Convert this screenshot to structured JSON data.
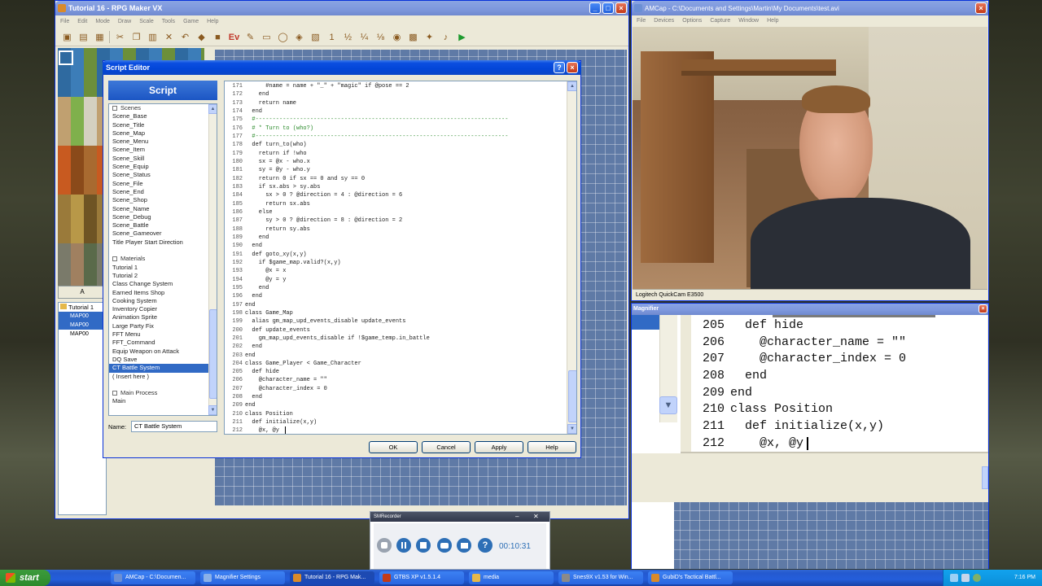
{
  "rpg_window": {
    "title": "Tutorial 16 - RPG Maker VX",
    "menu": [
      "File",
      "Edit",
      "Mode",
      "Draw",
      "Scale",
      "Tools",
      "Game",
      "Help"
    ],
    "palette_tab": "A",
    "map_tree_root": "Tutorial 1",
    "map_tree_items": [
      "MAP00",
      "MAP00",
      "MAP00"
    ]
  },
  "script_editor": {
    "title": "Script Editor",
    "help_icon": "?",
    "script_header": "Script",
    "list_items": [
      {
        "label": "Scenes",
        "head": true
      },
      {
        "label": "Scene_Base"
      },
      {
        "label": "Scene_Title"
      },
      {
        "label": "Scene_Map"
      },
      {
        "label": "Scene_Menu"
      },
      {
        "label": "Scene_Item"
      },
      {
        "label": "Scene_Skill"
      },
      {
        "label": "Scene_Equip"
      },
      {
        "label": "Scene_Status"
      },
      {
        "label": "Scene_File"
      },
      {
        "label": "Scene_End"
      },
      {
        "label": "Scene_Shop"
      },
      {
        "label": "Scene_Name"
      },
      {
        "label": "Scene_Debug"
      },
      {
        "label": "Scene_Battle"
      },
      {
        "label": "Scene_Gameover"
      },
      {
        "label": "Title Player Start Direction"
      },
      {
        "label": ""
      },
      {
        "label": "Materials",
        "head": true
      },
      {
        "label": "Tutorial 1"
      },
      {
        "label": "Tutorial 2"
      },
      {
        "label": "Class Change System"
      },
      {
        "label": "Earned Items Shop"
      },
      {
        "label": "Cooking System"
      },
      {
        "label": "Inventory Copier"
      },
      {
        "label": "Animation Sprite"
      },
      {
        "label": "Large Party Fix"
      },
      {
        "label": "FFT Menu"
      },
      {
        "label": "FFT_Command"
      },
      {
        "label": "Equip Weapon on Attack"
      },
      {
        "label": "DQ Save"
      },
      {
        "label": "CT Battle System",
        "selected": true
      },
      {
        "label": "( Insert here )"
      },
      {
        "label": ""
      },
      {
        "label": "Main Process",
        "head": true
      },
      {
        "label": "Main"
      }
    ],
    "name_label": "Name:",
    "name_value": "CT Battle System",
    "code_lines": [
      {
        "n": "171",
        "t": "      #name = name + \"_\" + \"magic\" if @pose == 2"
      },
      {
        "n": "172",
        "t": "    end"
      },
      {
        "n": "173",
        "t": "    return name"
      },
      {
        "n": "174",
        "t": "  end"
      },
      {
        "n": "175",
        "t": "  #--------------------------------------------------------------------------",
        "c": true
      },
      {
        "n": "176",
        "t": "  # * Turn to (who?)",
        "c": true
      },
      {
        "n": "177",
        "t": "  #--------------------------------------------------------------------------",
        "c": true
      },
      {
        "n": "178",
        "t": "  def turn_to(who)"
      },
      {
        "n": "179",
        "t": "    return if !who"
      },
      {
        "n": "180",
        "t": "    sx = @x - who.x"
      },
      {
        "n": "181",
        "t": "    sy = @y - who.y"
      },
      {
        "n": "182",
        "t": "    return 0 if sx == 0 and sy == 0"
      },
      {
        "n": "183",
        "t": "    if sx.abs > sy.abs"
      },
      {
        "n": "184",
        "t": "      sx > 0 ? @direction = 4 : @direction = 6"
      },
      {
        "n": "185",
        "t": "      return sx.abs"
      },
      {
        "n": "186",
        "t": "    else"
      },
      {
        "n": "187",
        "t": "      sy > 0 ? @direction = 8 : @direction = 2"
      },
      {
        "n": "188",
        "t": "      return sy.abs"
      },
      {
        "n": "189",
        "t": "    end"
      },
      {
        "n": "190",
        "t": "  end"
      },
      {
        "n": "191",
        "t": "  def goto_xy(x,y)"
      },
      {
        "n": "192",
        "t": "    if $game_map.valid?(x,y)"
      },
      {
        "n": "193",
        "t": "      @x = x"
      },
      {
        "n": "194",
        "t": "      @y = y"
      },
      {
        "n": "195",
        "t": "    end"
      },
      {
        "n": "196",
        "t": "  end"
      },
      {
        "n": "197",
        "t": "end"
      },
      {
        "n": "198",
        "t": "class Game_Map"
      },
      {
        "n": "199",
        "t": "  alias gm_map_upd_events_disable update_events"
      },
      {
        "n": "200",
        "t": "  def update_events"
      },
      {
        "n": "201",
        "t": "    gm_map_upd_events_disable if !$game_temp.in_battle"
      },
      {
        "n": "202",
        "t": "  end"
      },
      {
        "n": "203",
        "t": "end"
      },
      {
        "n": "204",
        "t": "class Game_Player < Game_Character"
      },
      {
        "n": "205",
        "t": "  def hide"
      },
      {
        "n": "206",
        "t": "    @character_name = \"\""
      },
      {
        "n": "207",
        "t": "    @character_index = 0"
      },
      {
        "n": "208",
        "t": "  end"
      },
      {
        "n": "209",
        "t": "end"
      },
      {
        "n": "210",
        "t": "class Position"
      },
      {
        "n": "211",
        "t": "  def initialize(x,y)"
      },
      {
        "n": "212",
        "t": "    @x, @y"
      }
    ],
    "buttons": {
      "ok": "OK",
      "cancel": "Cancel",
      "apply": "Apply",
      "help": "Help"
    }
  },
  "amcap": {
    "title": "AMCap - C:\\Documents and Settings\\Martin\\My Documents\\test.avi",
    "menu": [
      "File",
      "Devices",
      "Options",
      "Capture",
      "Window",
      "Help"
    ],
    "status": "Logitech QuickCam E3500"
  },
  "magnifier": {
    "title": "Magnifier",
    "lines": [
      {
        "n": "205",
        "t": "  def hide"
      },
      {
        "n": "206",
        "t": "    @character_name = \"\""
      },
      {
        "n": "207",
        "t": "    @character_index = 0"
      },
      {
        "n": "208",
        "t": "  end"
      },
      {
        "n": "209",
        "t": "end"
      },
      {
        "n": "210",
        "t": "class Position"
      },
      {
        "n": "211",
        "t": "  def initialize(x,y)"
      },
      {
        "n": "212",
        "t": "    @x, @y"
      }
    ]
  },
  "recorder": {
    "title": "SMRecorder",
    "time": "00:10:31"
  },
  "taskbar": {
    "start": "start",
    "tasks": [
      "AMCap - C:\\Documen...",
      "Magnifier Settings",
      "Tutorial 16 - RPG Mak...",
      "GTBS XP v1.5.1.4",
      "media",
      "Snes9X v1.53 for Win...",
      "GubiD's Tactical Battl..."
    ],
    "clock": "7:16 PM"
  }
}
